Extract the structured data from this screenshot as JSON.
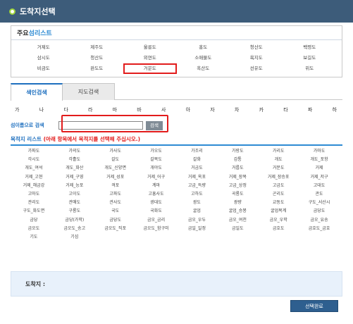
{
  "header": {
    "title": "도착지선택"
  },
  "major": {
    "title_part1": "주요",
    "title_part2": "섬리스트",
    "items": [
      "거제도",
      "제주도",
      "울릉도",
      "홍도",
      "청산도",
      "백령도",
      "삼시도",
      "청산도",
      "외연도",
      "소매물도",
      "욕지도",
      "보길도",
      "비금도",
      "완도도",
      "거문도",
      "흑산도",
      "선유도",
      "위도"
    ],
    "highlight_index": 14
  },
  "tabs": [
    {
      "label": "색인검색",
      "active": true
    },
    {
      "label": "지도검색",
      "active": false
    }
  ],
  "consonants": [
    "가",
    "나",
    "다",
    "라",
    "마",
    "바",
    "사",
    "아",
    "자",
    "차",
    "카",
    "타",
    "파",
    "하"
  ],
  "search": {
    "label": "섬이름으로 검색",
    "value": "",
    "button": "검색"
  },
  "dest_list": {
    "title_part1": "목적지 리스트",
    "title_part2": " (아래 항목에서 목적지를 선택해 주십시오.)",
    "items": [
      "가파도",
      "가의도",
      "가사도",
      "가오도",
      "가조리",
      "가랑도",
      "가리도",
      "가마도",
      "각시도",
      "각흘도",
      "갈도",
      "갈목도",
      "갈화",
      "감통",
      "개도",
      "개도_포항",
      "개도_여석",
      "개도_화산",
      "개도_신양면",
      "개야도",
      "거금도",
      "거룹도",
      "거문도",
      "거제",
      "거제_고현",
      "거제_구영",
      "거제_성포",
      "거제_어구",
      "거제_옥포",
      "거제_장목",
      "거제_장승포",
      "거제_저구",
      "거제_해금강",
      "거제_능포",
      "격포",
      "계마",
      "고금_득량",
      "고금_상정",
      "고금도",
      "고대도",
      "고마도",
      "고이도",
      "고파도",
      "고흥사도",
      "고하도",
      "곡룡도",
      "곤리도",
      "관도",
      "관리도",
      "관매도",
      "관사도",
      "광대도",
      "광도",
      "광량",
      "교동도",
      "구도_서산시",
      "구도_화도면",
      "구룡도",
      "국도",
      "국화도",
      "굴업",
      "굴업_승봉",
      "굴업목계",
      "금당도",
      "금당",
      "금당(가학)",
      "금당도",
      "금오_금리",
      "금오_우두",
      "금오_여천",
      "금오_우학",
      "금오_유송",
      "금오도",
      "금오도_송고",
      "금오도_직포",
      "금오도_함구미",
      "금일_일정",
      "금일도",
      "금호도",
      "금호도_금호",
      "기도",
      "기섬"
    ]
  },
  "destination": {
    "label": "도착지 :"
  },
  "confirm": {
    "label": "선택완료"
  },
  "colors": {
    "titlebar": "#3d5c7a",
    "accent_blue": "#2e8bd3",
    "highlight_red": "#e21c1c",
    "button": "#2e5f8f"
  }
}
